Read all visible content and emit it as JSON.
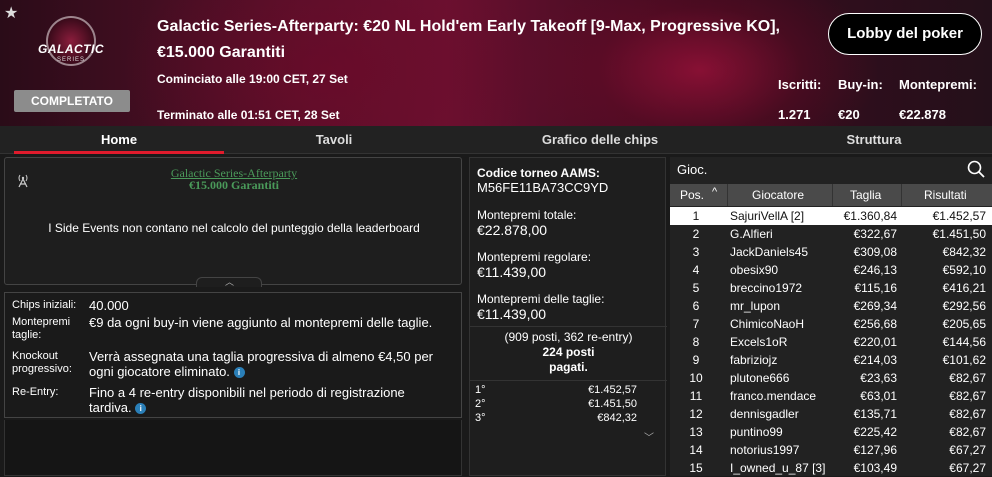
{
  "header": {
    "star": "★",
    "logo_text": "GALACTIC",
    "logo_sub": "SERIES",
    "status": "COMPLETATO",
    "title_line1": "Galactic Series-Afterparty: €20 NL Hold'em Early Takeoff [9-Max, Progressive KO],",
    "title_line2": "€15.000 Garantiti",
    "started": "Cominciato alle 19:00 CET, 27 Set",
    "ended": "Terminato alle 01:51 CET, 28 Set",
    "lobby_button": "Lobby del poker",
    "stats": {
      "registered_label": "Iscritti:",
      "registered_value": "1.271",
      "buyin_label": "Buy-in:",
      "buyin_value": "€20",
      "prizepool_label": "Montepremi:",
      "prizepool_value": "€22.878"
    }
  },
  "tabs": [
    "Home",
    "Tavoli",
    "Grafico delle chips",
    "Struttura"
  ],
  "left": {
    "event_title": "Galactic Series-Afterparty",
    "event_gtd": "€15.000 Garantiti",
    "note": "I Side Events non contano nel calcolo del punteggio della leaderboard",
    "info": [
      {
        "label": "Chips iniziali:",
        "value": "40.000"
      },
      {
        "label": "Montepremi taglie:",
        "value": "€9 da ogni buy-in viene aggiunto al montepremi delle taglie."
      },
      {
        "label": "Knockout progressivo:",
        "value": "Verrà assegnata una taglia progressiva di almeno €4,50 per ogni giocatore eliminato."
      },
      {
        "label": "Re-Entry:",
        "value": "Fino a 4 re-entry disponibili nel periodo di registrazione tardiva."
      }
    ],
    "info_icon": "i"
  },
  "middle": {
    "code_label": "Codice torneo AAMS:",
    "code_value": "M56FE11BA73CC9YD",
    "total_label": "Montepremi totale:",
    "total_value": "€22.878,00",
    "regular_label": "Montepremi regolare:",
    "regular_value": "€11.439,00",
    "bounty_label": "Montepremi delle taglie:",
    "bounty_value": "€11.439,00",
    "posts_line1": "(909 posti, 362 re-entry)",
    "posts_line2": "224 posti",
    "posts_line3": "pagati.",
    "prizes": [
      {
        "pos": "1°",
        "amount": "€1.452,57"
      },
      {
        "pos": "2°",
        "amount": "€1.451,50"
      },
      {
        "pos": "3°",
        "amount": "€842,32"
      }
    ]
  },
  "right": {
    "label": "Gioc.",
    "columns": {
      "pos": "Pos.",
      "player": "Giocatore",
      "bounty": "Taglia",
      "result": "Risultati"
    },
    "sort_icon": "^",
    "rows": [
      {
        "pos": "1",
        "name": "SajuriVellA [2]",
        "bounty": "€1.360,84",
        "result": "€1.452,57"
      },
      {
        "pos": "2",
        "name": "G.Alfieri",
        "bounty": "€322,67",
        "result": "€1.451,50"
      },
      {
        "pos": "3",
        "name": "JackDaniels45",
        "bounty": "€309,08",
        "result": "€842,32"
      },
      {
        "pos": "4",
        "name": "obesix90",
        "bounty": "€246,13",
        "result": "€592,10"
      },
      {
        "pos": "5",
        "name": "breccino1972",
        "bounty": "€115,16",
        "result": "€416,21"
      },
      {
        "pos": "6",
        "name": "mr_lupon",
        "bounty": "€269,34",
        "result": "€292,56"
      },
      {
        "pos": "7",
        "name": "ChimicoNaoH",
        "bounty": "€256,68",
        "result": "€205,65"
      },
      {
        "pos": "8",
        "name": "Excels1oR",
        "bounty": "€220,01",
        "result": "€144,56"
      },
      {
        "pos": "9",
        "name": "fabriziojz",
        "bounty": "€214,03",
        "result": "€101,62"
      },
      {
        "pos": "10",
        "name": "plutone666",
        "bounty": "€23,63",
        "result": "€82,67"
      },
      {
        "pos": "11",
        "name": "franco.mendace",
        "bounty": "€63,01",
        "result": "€82,67"
      },
      {
        "pos": "12",
        "name": "dennisgadler",
        "bounty": "€135,71",
        "result": "€82,67"
      },
      {
        "pos": "13",
        "name": "puntino99",
        "bounty": "€225,42",
        "result": "€82,67"
      },
      {
        "pos": "14",
        "name": "notorius1997",
        "bounty": "€127,96",
        "result": "€67,27"
      },
      {
        "pos": "15",
        "name": "I_owned_u_87 [3]",
        "bounty": "€103,49",
        "result": "€67,27"
      }
    ]
  },
  "colors": {
    "accent": "#e01b2c",
    "link_green": "#4a9a5a",
    "info_blue": "#2a7fb8"
  }
}
